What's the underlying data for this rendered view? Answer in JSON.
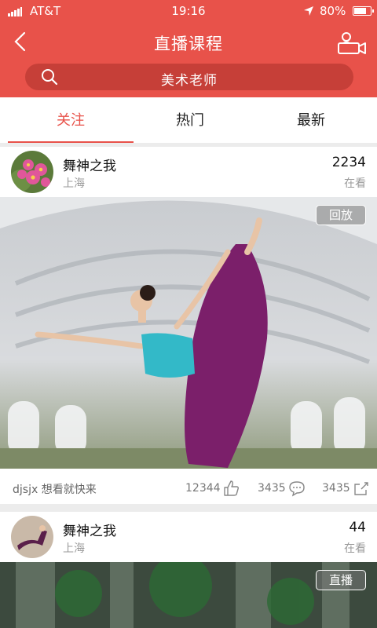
{
  "status_bar": {
    "carrier": "AT&T",
    "time": "19:16",
    "battery": "80%",
    "battery_level": 0.8
  },
  "nav": {
    "title": "直播课程",
    "back_icon": "chevron-left-icon",
    "camera_icon": "video-camera-user-icon"
  },
  "search": {
    "icon": "search-icon",
    "text": "美术老师"
  },
  "tabs": [
    {
      "label": "关注",
      "active": true
    },
    {
      "label": "热门",
      "active": false
    },
    {
      "label": "最新",
      "active": false
    }
  ],
  "colors": {
    "brand": "#e8524a",
    "search_bg": "#c63f38"
  },
  "cards": [
    {
      "name": "舞神之我",
      "location": "上海",
      "viewers": "2234",
      "viewers_label": "在看",
      "badge": "回放",
      "comment_user": "djsjx",
      "comment_text": "想看就快来",
      "likes": "12344",
      "comments": "3435",
      "shares": "3435"
    },
    {
      "name": "舞神之我",
      "location": "上海",
      "viewers": "44",
      "viewers_label": "在看",
      "badge": "直播"
    }
  ]
}
